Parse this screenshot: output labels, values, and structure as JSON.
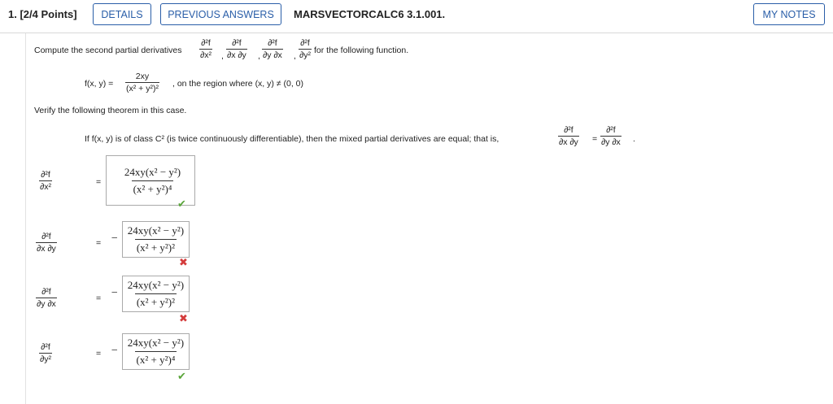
{
  "header": {
    "question_label": "1. [2/4 Points]",
    "details_label": "DETAILS",
    "previous_answers_label": "PREVIOUS ANSWERS",
    "question_id": "MARSVECTORCALC6 3.1.001.",
    "my_notes_label": "MY NOTES"
  },
  "problem": {
    "intro_text": "Compute the second partial derivatives",
    "intro_suffix": "for the following function.",
    "derivs": [
      {
        "num": "∂²f",
        "den": "∂x²"
      },
      {
        "num": "∂²f",
        "den": "∂x ∂y"
      },
      {
        "num": "∂²f",
        "den": "∂y ∂x"
      },
      {
        "num": "∂²f",
        "den": "∂y²"
      }
    ],
    "function_lhs": "f(x, y) =",
    "function_num": "2xy",
    "function_den": "(x² + y²)²",
    "function_suffix": ", on the region where (x, y) ≠ (0, 0)",
    "verify_text": "Verify the following theorem in this case.",
    "theorem_text": "If f(x, y) is of class C² (is twice continuously differentiable), then the mixed partial derivatives are equal; that is,",
    "theorem_lhs": {
      "num": "∂²f",
      "den": "∂x ∂y"
    },
    "theorem_eq": "=",
    "theorem_rhs": {
      "num": "∂²f",
      "den": "∂y ∂x"
    },
    "theorem_end": "."
  },
  "answers": [
    {
      "label_num": "∂²f",
      "label_den": "∂x²",
      "eq": "=",
      "sign": "",
      "num": "24xy(x² − y²)",
      "den": "(x² + y²)⁴",
      "status": "correct"
    },
    {
      "label_num": "∂²f",
      "label_den": "∂x ∂y",
      "eq": "=",
      "sign": "−",
      "num": "24xy(x² − y²)",
      "den": "(x² + y²)²",
      "status": "incorrect"
    },
    {
      "label_num": "∂²f",
      "label_den": "∂y ∂x",
      "eq": "=",
      "sign": "−",
      "num": "24xy(x² − y²)",
      "den": "(x² + y²)²",
      "status": "incorrect"
    },
    {
      "label_num": "∂²f",
      "label_den": "∂y²",
      "eq": "=",
      "sign": "−",
      "num": "24xy(x² − y²)",
      "den": "(x² + y²)⁴",
      "status": "correct"
    }
  ],
  "icons": {
    "check": "✔",
    "cross": "✖"
  },
  "colors": {
    "accent": "#2a5ea8",
    "correct": "#5aa53a",
    "incorrect": "#d43c3c"
  }
}
